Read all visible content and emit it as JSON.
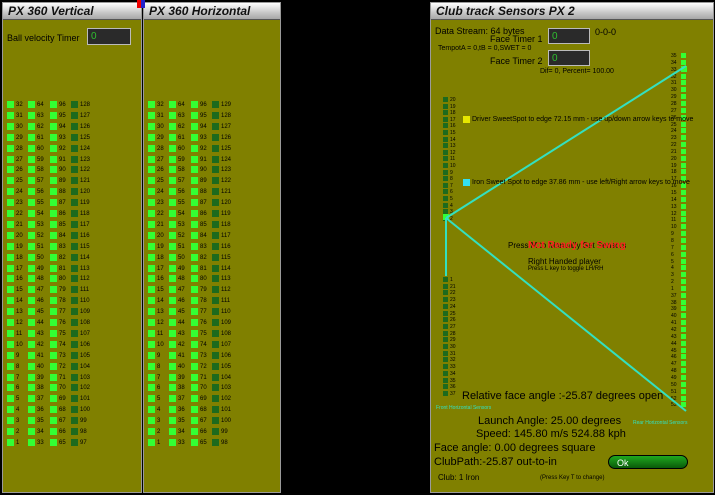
{
  "vertical": {
    "title": "PX 360 Vertical",
    "ball_velocity_label": "Ball velocity Timer",
    "ball_velocity_value": "0",
    "col1": [
      "32",
      "31",
      "30",
      "29",
      "28",
      "27",
      "26",
      "25",
      "24",
      "23",
      "22",
      "21",
      "20",
      "19",
      "18",
      "17",
      "16",
      "15",
      "14",
      "13",
      "12",
      "11",
      "10",
      "9",
      "8",
      "7",
      "6",
      "5",
      "4",
      "3",
      "2",
      "1"
    ],
    "col2": [
      "64",
      "63",
      "62",
      "61",
      "60",
      "59",
      "58",
      "57",
      "56",
      "55",
      "54",
      "53",
      "52",
      "51",
      "50",
      "49",
      "48",
      "47",
      "46",
      "45",
      "44",
      "43",
      "42",
      "41",
      "40",
      "39",
      "38",
      "37",
      "36",
      "35",
      "34",
      "33"
    ],
    "col3": [
      "96",
      "95",
      "94",
      "93",
      "92",
      "91",
      "90",
      "89",
      "88",
      "87",
      "86",
      "85",
      "84",
      "83",
      "82",
      "81",
      "80",
      "79",
      "78",
      "77",
      "76",
      "75",
      "74",
      "73",
      "72",
      "71",
      "70",
      "69",
      "68",
      "67",
      "66",
      "65"
    ],
    "col4": [
      "128",
      "127",
      "126",
      "125",
      "124",
      "123",
      "122",
      "121",
      "120",
      "119",
      "118",
      "117",
      "116",
      "115",
      "114",
      "113",
      "112",
      "111",
      "110",
      "109",
      "108",
      "107",
      "106",
      "105",
      "104",
      "103",
      "102",
      "101",
      "100",
      "99",
      "98",
      "97"
    ]
  },
  "horizontal": {
    "title": "PX 360 Horizontal",
    "col1": [
      "32",
      "31",
      "30",
      "29",
      "28",
      "27",
      "26",
      "25",
      "24",
      "23",
      "22",
      "21",
      "20",
      "19",
      "18",
      "17",
      "16",
      "15",
      "14",
      "13",
      "12",
      "11",
      "10",
      "9",
      "8",
      "7",
      "6",
      "5",
      "4",
      "3",
      "2",
      "1"
    ],
    "col2": [
      "64",
      "63",
      "62",
      "61",
      "60",
      "59",
      "58",
      "57",
      "56",
      "55",
      "54",
      "53",
      "52",
      "51",
      "50",
      "49",
      "48",
      "47",
      "46",
      "45",
      "44",
      "43",
      "42",
      "41",
      "40",
      "39",
      "38",
      "37",
      "36",
      "35",
      "34",
      "33"
    ],
    "col3": [
      "96",
      "95",
      "94",
      "93",
      "92",
      "91",
      "90",
      "89",
      "88",
      "87",
      "86",
      "85",
      "84",
      "83",
      "82",
      "81",
      "80",
      "79",
      "78",
      "77",
      "76",
      "75",
      "74",
      "73",
      "72",
      "71",
      "70",
      "69",
      "68",
      "67",
      "66",
      "65"
    ],
    "col4": [
      "129",
      "128",
      "127",
      "126",
      "125",
      "124",
      "123",
      "122",
      "121",
      "120",
      "119",
      "118",
      "117",
      "116",
      "115",
      "114",
      "113",
      "112",
      "111",
      "110",
      "109",
      "108",
      "107",
      "106",
      "105",
      "104",
      "103",
      "102",
      "101",
      "100",
      "99",
      "98"
    ]
  },
  "club": {
    "title": "Club track Sensors PX 2",
    "data_stream": "Data Stream: 64 bytes",
    "face_timer1_label": "Face Timer 1",
    "face_timer1_value": "0",
    "face_timer2_label": "Face Timer 2",
    "face_timer2_value": "0",
    "code": "0-0-0",
    "tempo": "TempotA = 0,tB = 0,SWET = 0",
    "dif": "Dif= 0,  Percent= 100.00",
    "driver_note": "Driver SweetSpot to edge 72.15 mm - use up/down arrow keys to move",
    "iron_note": "Iron Sweet Spot to edge 37.86 mm - use left/Right arrow keys to move",
    "manual": "Press M to Manually Set Sensors",
    "not_ready": "Not Ready for Swing",
    "handed": "Right Handed player",
    "toggle": "Press L key to toggle LH/RH",
    "rel_face": "Relative face angle :-25.87 degrees open",
    "launch": "Launch Angle: 25.00 degrees",
    "speed": "Speed: 145.80 m/s  524.88 kph",
    "face_angle": "Face angle: 0.00 degrees square",
    "club_path": "ClubPath:-25.87 out-to-in",
    "club_type": "Club: 1 Iron",
    "change_hint": "(Press Key T to change)",
    "ok_label": "Ok",
    "front_label": "Front Horizontal Sensors",
    "rear_label": "Rear Horizontal Sensors",
    "left_top": [
      "20",
      "19",
      "18",
      "17",
      "16",
      "15",
      "14",
      "13",
      "12",
      "11",
      "10",
      "9",
      "8",
      "7",
      "6",
      "5",
      "4",
      "3",
      "2"
    ],
    "left_bottom": [
      "1",
      "21",
      "22",
      "23",
      "24",
      "25",
      "26",
      "27",
      "28",
      "29",
      "30",
      "31",
      "32",
      "33",
      "34",
      "35",
      "36",
      "37"
    ],
    "right": [
      "35",
      "34",
      "33",
      "32",
      "31",
      "30",
      "29",
      "28",
      "27",
      "26",
      "25",
      "24",
      "23",
      "22",
      "21",
      "20",
      "19",
      "18",
      "17",
      "16",
      "15",
      "14",
      "13",
      "12",
      "11",
      "10",
      "9",
      "8",
      "7",
      "6",
      "5",
      "4",
      "3",
      "2",
      "1",
      "37",
      "38",
      "39",
      "40",
      "41",
      "42",
      "43",
      "44",
      "45",
      "46",
      "47",
      "48",
      "49",
      "50",
      "51",
      "52",
      "53"
    ],
    "accent_line": "#33e0c0",
    "status_red": "#ff2020"
  }
}
